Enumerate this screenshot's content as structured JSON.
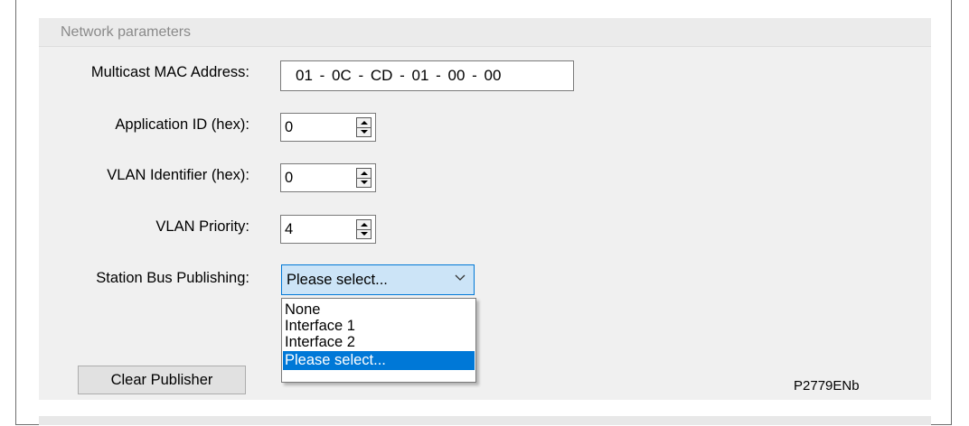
{
  "group": {
    "title": "Network parameters"
  },
  "fields": {
    "mac": {
      "label": "Multicast MAC Address:",
      "value": "01 - 0C - CD - 01 - 00 - 00"
    },
    "app_id": {
      "label": "Application ID (hex):",
      "value": "0"
    },
    "vlan_id": {
      "label": "VLAN Identifier (hex):",
      "value": "0"
    },
    "vlan_priority": {
      "label": "VLAN Priority:",
      "value": "4"
    },
    "station_bus": {
      "label": "Station Bus Publishing:",
      "value": "Please select...",
      "options": [
        "None",
        "Interface 1",
        "Interface 2",
        "Please select..."
      ],
      "highlighted_option": "Please select..."
    }
  },
  "buttons": {
    "clear_publisher": "Clear Publisher"
  },
  "figure_ref": "P2779ENb",
  "icons": {
    "spinner": "spin-updown-icon",
    "dropdown": "chevron-down-icon"
  },
  "colors": {
    "selection": "#0078d7",
    "combo_focus": "#cce4f7"
  }
}
